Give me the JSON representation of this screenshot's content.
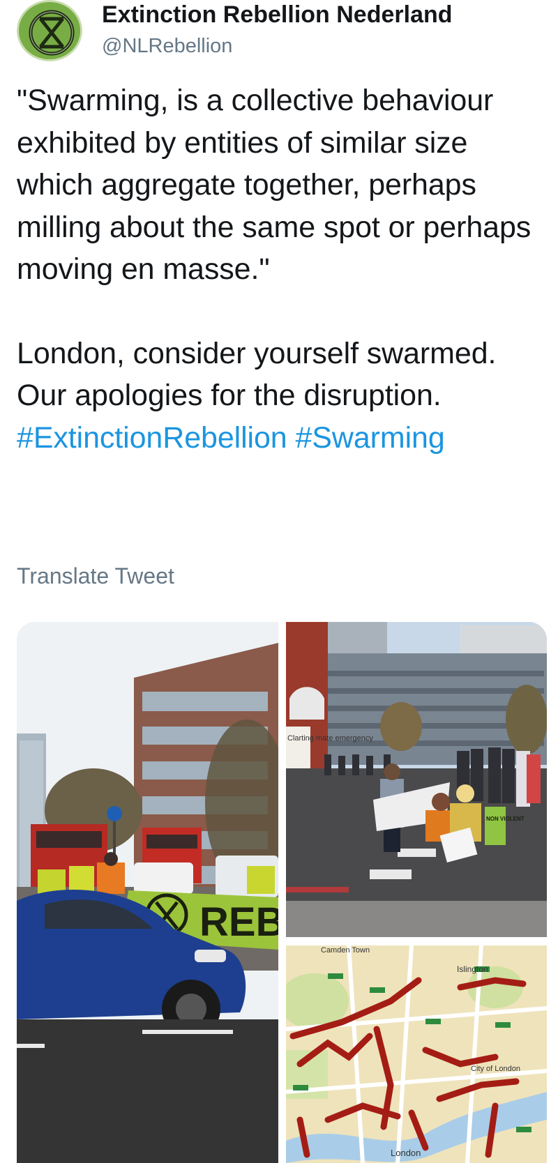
{
  "account": {
    "display_name": "Extinction Rebellion Nederland",
    "handle": "@NLRebellion",
    "avatar_icon": "extinction-symbol-icon"
  },
  "tweet": {
    "paragraph_1": "\"Swarming, is a collective behaviour exhibited by entities of similar size which aggregate together, perhaps milling about the same spot or perhaps moving en masse.\"",
    "paragraph_2_text": "London, consider yourself swarmed. Our apologies for the disruption. ",
    "hashtags": [
      "#ExtinctionRebellion",
      "#Swarming"
    ],
    "translate_label": "Translate Tweet"
  },
  "media": {
    "photos": [
      {
        "description_icon": "street-protest-photo",
        "banner_text": "REB"
      },
      {
        "description_icon": "crosswalk-protest-photo",
        "sign_text": "NON VIOLENT",
        "poster_text": "Clarting mate emergency"
      },
      {
        "description_icon": "london-traffic-map-photo",
        "labels": [
          "Camden Town",
          "Islington",
          "City of London",
          "London"
        ]
      }
    ]
  },
  "colors": {
    "hashtag": "#1b95e0",
    "secondary_text": "#657786",
    "primary_text": "#14171a",
    "xr_green": "#7fb24a"
  }
}
